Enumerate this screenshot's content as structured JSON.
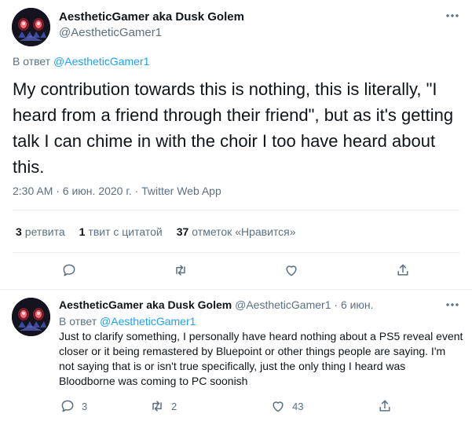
{
  "main_tweet": {
    "display_name": "AestheticGamer aka Dusk Golem",
    "handle": "@AestheticGamer1",
    "more_icon": "more-dots-icon",
    "reply_prefix": "В ответ",
    "reply_to": "@AestheticGamer1",
    "text": "My contribution towards this is nothing, this is literally, \"I heard from a friend through their friend\", but as it's getting talk I can chime in with the choir I too have heard about this.",
    "timestamp": "2:30 AM · 6 июн. 2020 г. · ",
    "source": "Twitter Web App",
    "stats": {
      "retweets_count": "3",
      "retweets_label": "ретвита",
      "quotes_count": "1",
      "quotes_label": "твит с цитатой",
      "likes_count": "37",
      "likes_label": "отметок «Нравится»"
    },
    "actions": [
      "reply-icon",
      "retweet-icon",
      "like-icon",
      "share-icon"
    ]
  },
  "reply_tweet": {
    "display_name": "AestheticGamer aka Dusk Golem",
    "handle": "@AestheticGamer1",
    "separator": "·",
    "date": "6 июн.",
    "more_icon": "more-dots-icon",
    "reply_prefix": "В ответ",
    "reply_to": "@AestheticGamer1",
    "text": "Just to clarify something, I personally have heard nothing about a PS5 reveal event closer or it being remastered by Bluepoint or other things people are saying. I'm not saying that is or isn't true specifically, just the only thing I heard was Bloodborne was coming to PC soonish",
    "reply_count": "3",
    "retweet_count": "2",
    "like_count": "43"
  },
  "colors": {
    "accent": "#1da1f2",
    "secondary_text": "#5b7083",
    "border": "#e6ecf0"
  }
}
